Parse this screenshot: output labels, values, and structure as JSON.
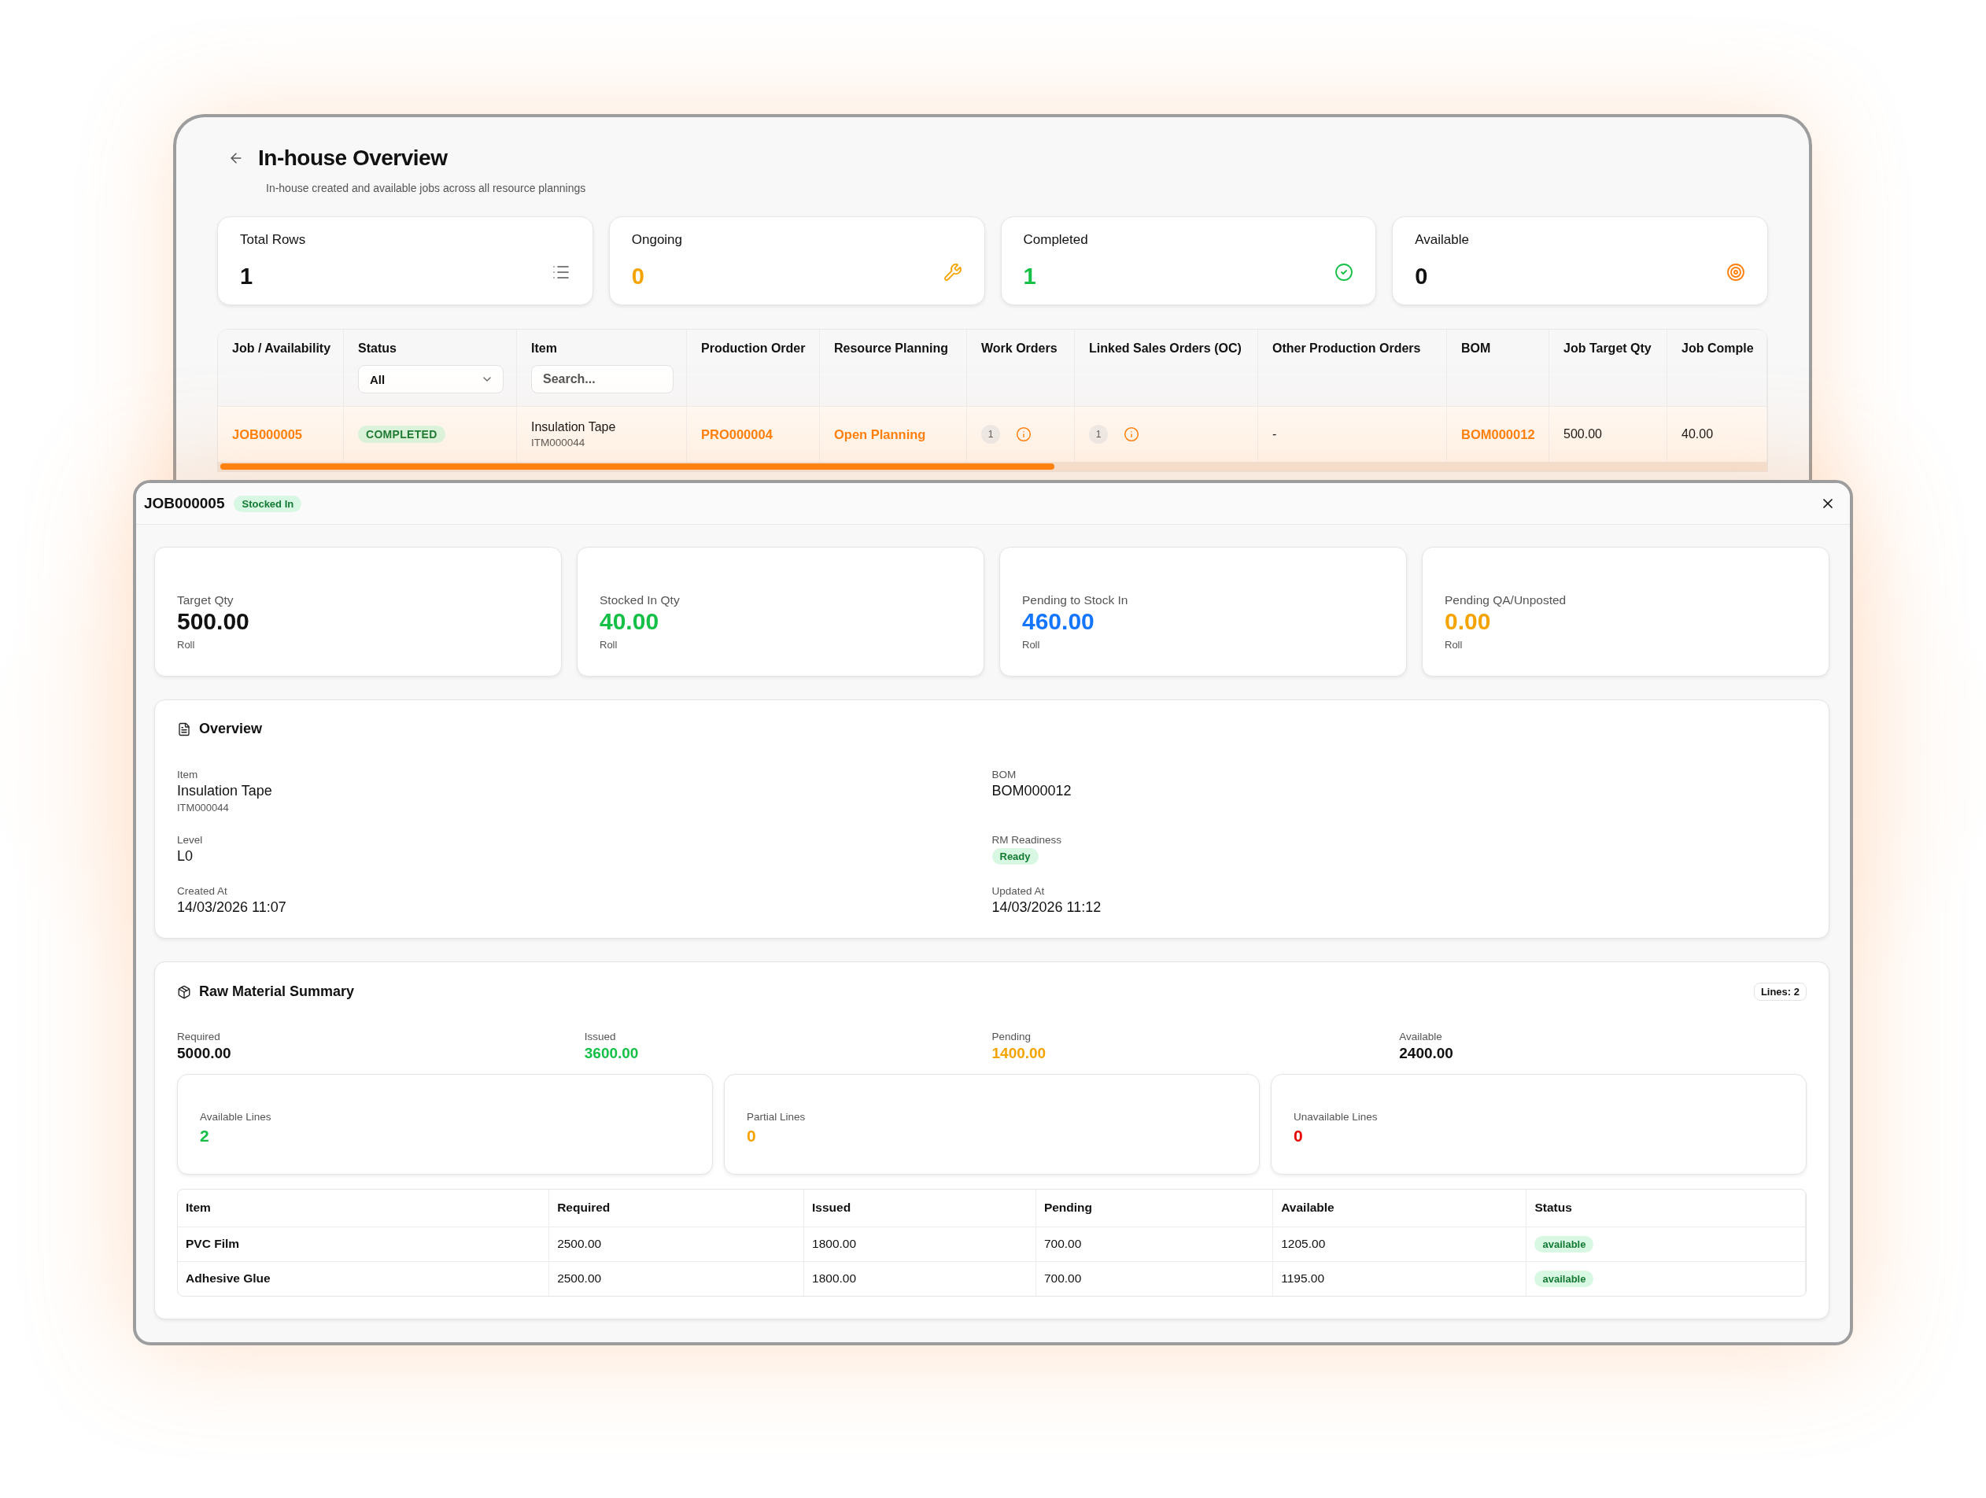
{
  "back_window": {
    "title": "In-house Overview",
    "subtitle": "In-house created and available jobs across all resource plannings",
    "stats": [
      {
        "label": "Total Rows",
        "value": "1",
        "color": "#111111"
      },
      {
        "label": "Ongoing",
        "value": "0",
        "color": "#f5a300"
      },
      {
        "label": "Completed",
        "value": "1",
        "color": "#16c047"
      },
      {
        "label": "Available",
        "value": "0",
        "color": "#111111"
      }
    ],
    "table": {
      "columns": [
        {
          "label": "Job / Availability"
        },
        {
          "label": "Status",
          "filter": {
            "kind": "select",
            "value": "All"
          }
        },
        {
          "label": "Item",
          "filter": {
            "kind": "search",
            "placeholder": "Search..."
          }
        },
        {
          "label": "Production Order"
        },
        {
          "label": "Resource Planning"
        },
        {
          "label": "Work Orders"
        },
        {
          "label": "Linked Sales Orders (OC)"
        },
        {
          "label": "Other Production Orders"
        },
        {
          "label": "BOM"
        },
        {
          "label": "Job Target Qty"
        },
        {
          "label": "Job Comple"
        }
      ],
      "rows": [
        {
          "cells": [
            {
              "kind": "link",
              "text": "JOB000005"
            },
            {
              "kind": "badge",
              "text": "COMPLETED"
            },
            {
              "kind": "item",
              "text": "Insulation Tape",
              "code": "ITM000044"
            },
            {
              "kind": "link",
              "text": "PRO000004"
            },
            {
              "kind": "link",
              "text": "Open Planning"
            },
            {
              "kind": "count",
              "text": "1"
            },
            {
              "kind": "count",
              "text": "1"
            },
            {
              "kind": "text",
              "text": "-"
            },
            {
              "kind": "link",
              "text": "BOM000012"
            },
            {
              "kind": "text",
              "text": "500.00"
            },
            {
              "kind": "text",
              "text": "40.00"
            }
          ]
        }
      ]
    }
  },
  "modal": {
    "title": "JOB000005",
    "badge": "Stocked In",
    "stats": [
      {
        "label": "Target Qty",
        "value": "500.00",
        "unit": "Roll",
        "color": "#111111"
      },
      {
        "label": "Stocked In Qty",
        "value": "40.00",
        "unit": "Roll",
        "color": "#16c047"
      },
      {
        "label": "Pending to Stock In",
        "value": "460.00",
        "unit": "Roll",
        "color": "#1476ff"
      },
      {
        "label": "Pending QA/Unposted",
        "value": "0.00",
        "unit": "Roll",
        "color": "#f5a300"
      }
    ],
    "overview": {
      "title": "Overview",
      "fields": [
        {
          "kind": "text",
          "label": "Item",
          "value": "Insulation Tape",
          "sub": "ITM000044"
        },
        {
          "kind": "text",
          "label": "BOM",
          "value": "BOM000012"
        },
        {
          "kind": "text",
          "label": "Level",
          "value": "L0"
        },
        {
          "kind": "badge",
          "label": "RM Readiness",
          "value": "Ready"
        },
        {
          "kind": "text",
          "label": "Created At",
          "value": "14/03/2026 11:07"
        },
        {
          "kind": "text",
          "label": "Updated At",
          "value": "14/03/2026 11:12"
        }
      ]
    },
    "raw_material": {
      "title": "Raw Material Summary",
      "lines": "Lines: 2",
      "totals": [
        {
          "label": "Required",
          "value": "5000.00",
          "color": "#111111"
        },
        {
          "label": "Issued",
          "value": "3600.00",
          "color": "#16c047"
        },
        {
          "label": "Pending",
          "value": "1400.00",
          "color": "#f5a300"
        },
        {
          "label": "Available",
          "value": "2400.00",
          "color": "#111111"
        }
      ],
      "line_stats": [
        {
          "label": "Available Lines",
          "value": "2",
          "color": "#16c047"
        },
        {
          "label": "Partial Lines",
          "value": "0",
          "color": "#f5a300"
        },
        {
          "label": "Unavailable Lines",
          "value": "0",
          "color": "#e60000"
        }
      ],
      "table": {
        "columns": [
          "Item",
          "Required",
          "Issued",
          "Pending",
          "Available",
          "Status"
        ],
        "rows": [
          {
            "cells": [
              "PVC Film",
              "2500.00",
              "1800.00",
              "700.00",
              "1205.00"
            ],
            "status": "available"
          },
          {
            "cells": [
              "Adhesive Glue",
              "2500.00",
              "1800.00",
              "700.00",
              "1195.00"
            ],
            "status": "available"
          }
        ]
      }
    }
  }
}
